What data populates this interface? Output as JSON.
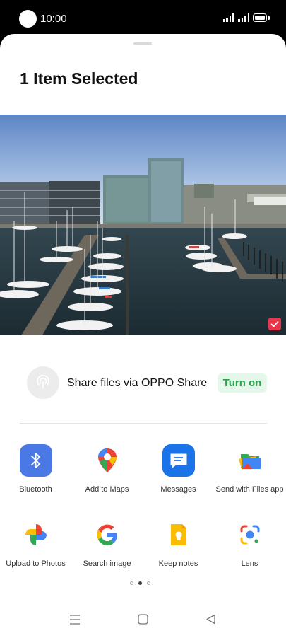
{
  "status_bar": {
    "time": "10:00"
  },
  "header": {
    "title": "1 Item Selected"
  },
  "photo": {
    "selected": true
  },
  "oppo_share": {
    "text": "Share files via OPPO Share",
    "button": "Turn on"
  },
  "apps": [
    {
      "label": "Bluetooth",
      "icon": "bluetooth-icon"
    },
    {
      "label": "Add to Maps",
      "icon": "maps-icon"
    },
    {
      "label": "Messages",
      "icon": "messages-icon"
    },
    {
      "label": "Send with Files app",
      "icon": "files-icon"
    },
    {
      "label": "Upload to Photos",
      "icon": "photos-icon"
    },
    {
      "label": "Search image",
      "icon": "google-icon"
    },
    {
      "label": "Keep notes",
      "icon": "keep-icon"
    },
    {
      "label": "Lens",
      "icon": "lens-icon"
    }
  ],
  "pagination": {
    "pages": 3,
    "current": 2
  },
  "colors": {
    "accent_green": "#23a84a",
    "check_red": "#e8364a",
    "bluetooth_blue": "#4a79e6"
  }
}
